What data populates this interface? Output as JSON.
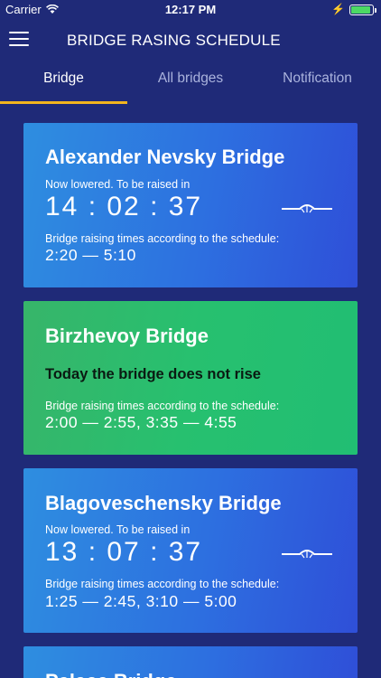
{
  "status_bar": {
    "carrier": "Carrier",
    "time": "12:17 PM",
    "battery_level": 0.9
  },
  "nav": {
    "title": "BRIDGE RASING SCHEDULE"
  },
  "tabs": [
    {
      "label": "Bridge",
      "active": true
    },
    {
      "label": "All bridges",
      "active": false
    },
    {
      "label": "Notification",
      "active": false
    }
  ],
  "cards": [
    {
      "name": "Alexander Nevsky Bridge",
      "status": "Now lowered. To be raised in",
      "countdown": "14 : 02 : 37",
      "schedule_label": "Bridge raising times according to the schedule:",
      "times": "2:20 — 5:10"
    },
    {
      "name": "Birzhevoy Bridge",
      "message": "Today the bridge does not rise",
      "schedule_label": "Bridge raising times according to the schedule:",
      "times": "2:00 — 2:55, 3:35 — 4:55"
    },
    {
      "name": "Blagoveschensky Bridge",
      "status": "Now lowered. To be raised in",
      "countdown": "13 : 07 : 37",
      "schedule_label": "Bridge raising times according to the schedule:",
      "times": "1:25 — 2:45, 3:10 — 5:00"
    },
    {
      "name": "Palace Bridge"
    }
  ],
  "colors": {
    "background": "#1f2a78",
    "card_blue": "#2d6fe0",
    "card_green": "#27c06f",
    "tab_indicator": "#f2b51f"
  }
}
